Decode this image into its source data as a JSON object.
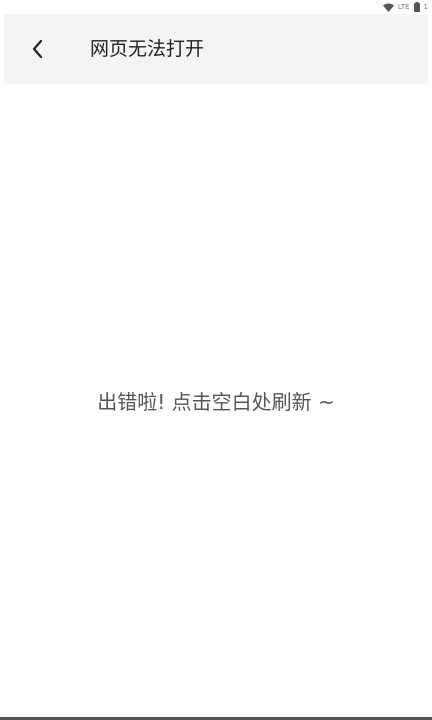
{
  "status_bar": {
    "icons": [
      "wifi-icon",
      "signal-icon",
      "battery-icon"
    ],
    "signal_text": "LTE",
    "battery_text": "1"
  },
  "header": {
    "back_icon": "chevron-left-icon",
    "title": "网页无法打开",
    "background": "#f4f4f4"
  },
  "main": {
    "error_message": "出错啦! 点击空白处刷新 ~"
  }
}
